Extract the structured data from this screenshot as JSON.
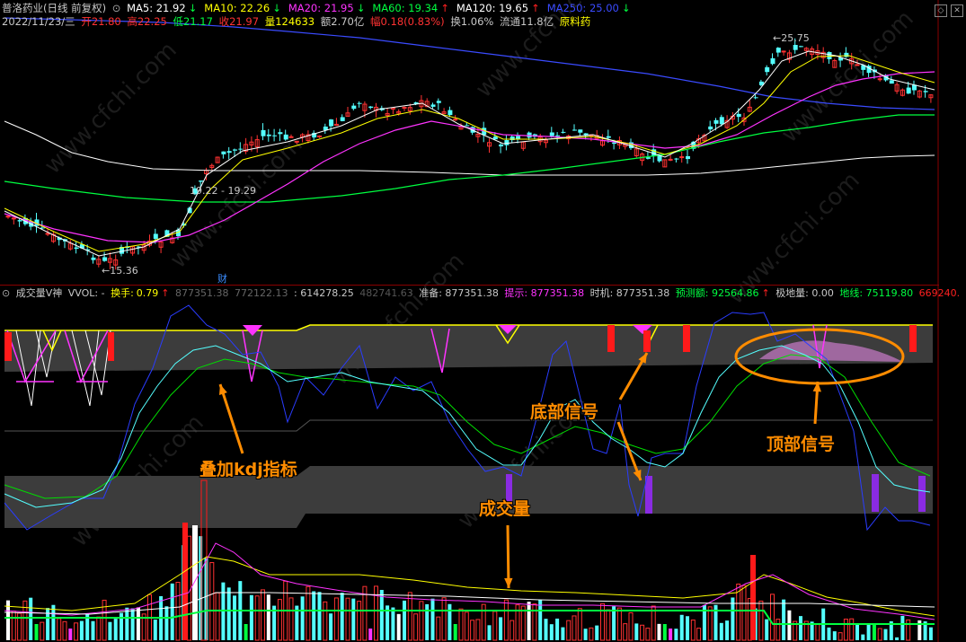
{
  "header1": {
    "stock": "普洛药业(日线 前复权)",
    "ma": [
      {
        "label": "MA5: 21.92",
        "arrow": "↓",
        "color": "#ffffff",
        "arrow_color": "#00ff40"
      },
      {
        "label": "MA10: 22.26",
        "arrow": "↓",
        "color": "#ffff00",
        "arrow_color": "#00ff40"
      },
      {
        "label": "MA20: 21.95",
        "arrow": "↓",
        "color": "#ff33ff",
        "arrow_color": "#00ff40"
      },
      {
        "label": "MA60: 19.34",
        "arrow": "↑",
        "color": "#00ff40",
        "arrow_color": "#ff2020"
      },
      {
        "label": "MA120: 19.65",
        "arrow": "↑",
        "color": "#ffffff",
        "arrow_color": "#ff2020"
      },
      {
        "label": "MA250: 25.00",
        "arrow": "↓",
        "color": "#3a4bff",
        "arrow_color": "#00ff40"
      }
    ]
  },
  "header2": {
    "date": "2022/11/23/三",
    "open": "开21.80",
    "high": "高22.25",
    "low": "低21.17",
    "close": "收21.97",
    "vol": "量124633",
    "amt": "额2.70亿",
    "chg": "幅0.18(0.83%)",
    "turn": "换1.06%",
    "float": "流通11.8亿",
    "industry": "原料药"
  },
  "price_annotations": {
    "high": "25.75",
    "low": "15.36",
    "range": "19.22 - 19.29",
    "marker": "财"
  },
  "panel2": {
    "name": "成交量V神",
    "vol": "VVOL: -",
    "turnover_label": "换手:",
    "turnover_value": "0.79",
    "turnover_arrow": "↑",
    "v1": "877351.38",
    "v2": "772122.13",
    "v3": ": 614278.25",
    "v4": "482741.63",
    "prep": "准备: 877351.38",
    "hint": "提示: 877351.38",
    "timing": "时机: 877351.38",
    "forecast": "预测额: 92564.86",
    "forecast_arrow": "↑",
    "extreme": "极地量: 0.00",
    "ground": "地线: 75119.80",
    "last": "669240."
  },
  "annotations": {
    "kdj": "叠加kdj指标",
    "bottom": "底部信号",
    "top": "顶部信号",
    "volume": "成交量"
  },
  "watermark": "www.cfchi.com",
  "colors": {
    "up": "#ff3232",
    "down": "#54ffff",
    "ma5": "#ffffff",
    "ma10": "#ffff00",
    "ma20": "#ff33ff",
    "ma60": "#00ff40",
    "ma250": "#3a4bff",
    "annotation": "#ff8c00",
    "separator": "#8a0000"
  }
}
